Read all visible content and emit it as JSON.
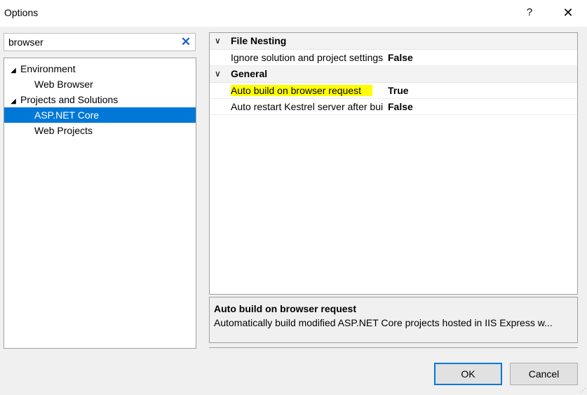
{
  "window": {
    "title": "Options",
    "help_label": "?",
    "close_label": "✕"
  },
  "search": {
    "value": "browser",
    "clear_label": "✕"
  },
  "tree": {
    "items": [
      {
        "label": "Environment",
        "arrow": "◢"
      },
      {
        "label": "Web Browser"
      },
      {
        "label": "Projects and Solutions",
        "arrow": "◢"
      },
      {
        "label": "ASP.NET Core"
      },
      {
        "label": "Web Projects"
      }
    ]
  },
  "grid": {
    "categories": [
      {
        "label": "File Nesting",
        "chevron": "∨",
        "properties": [
          {
            "name": "Ignore solution and project settings",
            "value": "False"
          }
        ]
      },
      {
        "label": "General",
        "chevron": "∨",
        "properties": [
          {
            "name": "Auto build on browser request",
            "value": "True"
          },
          {
            "name": "Auto restart Kestrel server after build",
            "value": "False"
          }
        ]
      }
    ]
  },
  "description": {
    "title": "Auto build on browser request",
    "text": "Automatically build modified ASP.NET Core projects hosted in IIS Express w..."
  },
  "buttons": {
    "ok": "OK",
    "cancel": "Cancel"
  },
  "colors": {
    "selection": "#0078d7",
    "highlight": "#ffff00",
    "clear_icon": "#1e63c6"
  }
}
